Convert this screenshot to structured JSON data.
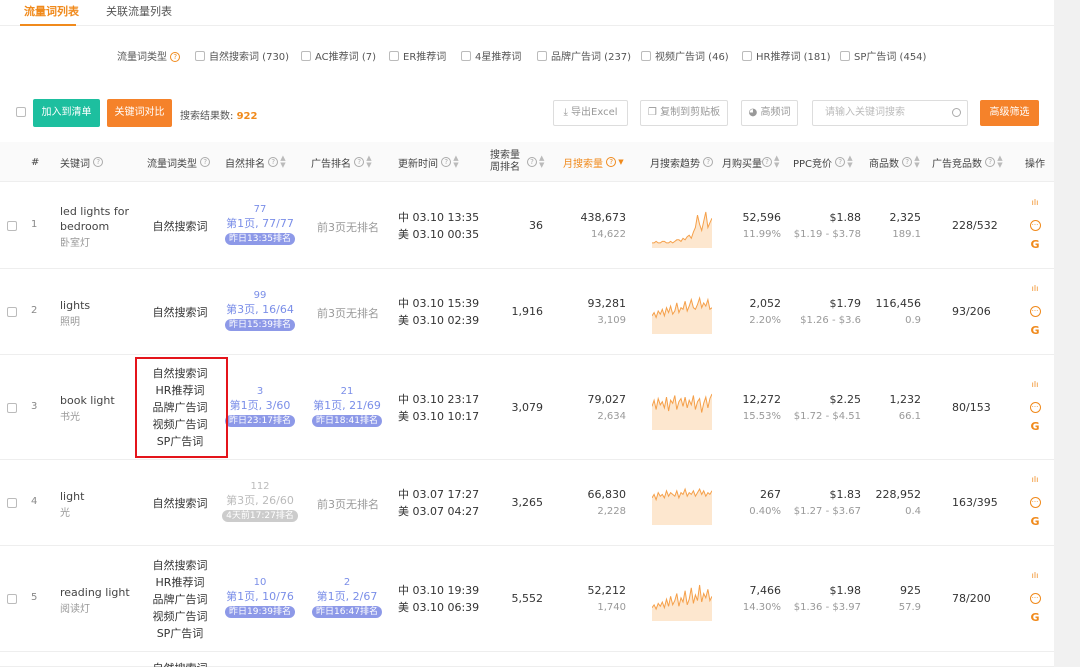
{
  "tabs": [
    "流量词列表",
    "关联流量列表"
  ],
  "filter": {
    "label": "流量词类型",
    "options": [
      "自然搜索词 (730)",
      "AC推荐词 (7)",
      "ER推荐词",
      "4星推荐词",
      "品牌广告词 (237)",
      "视频广告词 (46)",
      "HR推荐词 (181)",
      "SP广告词 (454)"
    ]
  },
  "toolbar": {
    "add_list": "加入到清单",
    "compare": "关键词对比",
    "result_label": "搜索结果数:",
    "result_count": "922",
    "export": "导出Excel",
    "copy": "复制到剪贴板",
    "high_freq": "高频词",
    "search_placeholder": "请输入关键词搜索",
    "advanced": "高级筛选"
  },
  "columns": [
    "#",
    "关键词",
    "流量词类型",
    "自然排名",
    "广告排名",
    "更新时间",
    "搜索量周排名",
    "月搜索量",
    "月搜索趋势",
    "月购买量",
    "PPC竞价",
    "商品数",
    "广告竞品数",
    "操作"
  ],
  "rows": [
    {
      "idx": "1",
      "kw": "led lights for bedroom",
      "kw_line1": "led lights for",
      "kw_line2": "bedroom",
      "cn": "卧室灯",
      "types": [
        "自然搜索词"
      ],
      "nat": {
        "top": "77",
        "pos": "第1页, 77/77",
        "pill": "昨日13:35排名",
        "grey": false
      },
      "ad": {
        "none": "前3页无排名"
      },
      "t1": "中 03.10 13:35",
      "t2": "美 03.10 00:35",
      "weekly": "36",
      "vol": "438,673",
      "vol2": "14,622",
      "buy": "52,596",
      "buy2": "11.99%",
      "ppc": "$1.88",
      "ppc2": "$1.19 - $3.78",
      "goods": "2,325",
      "goods2": "189.1",
      "adc": "228/532",
      "trend": [
        2,
        2,
        3,
        2,
        2,
        3,
        3,
        2,
        2,
        3,
        2,
        3,
        4,
        4,
        3,
        5,
        4,
        6,
        7,
        5,
        9,
        12,
        20,
        14,
        10,
        16,
        22,
        12,
        15,
        18
      ]
    },
    {
      "idx": "2",
      "kw": "lights",
      "kw_line1": "lights",
      "kw_line2": "",
      "cn": "照明",
      "types": [
        "自然搜索词"
      ],
      "nat": {
        "top": "99",
        "pos": "第3页, 16/64",
        "pill": "昨日15:39排名",
        "grey": false
      },
      "ad": {
        "none": "前3页无排名"
      },
      "t1": "中 03.10 15:39",
      "t2": "美 03.10 02:39",
      "weekly": "1,916",
      "vol": "93,281",
      "vol2": "3,109",
      "buy": "2,052",
      "buy2": "2.20%",
      "ppc": "$1.79",
      "ppc2": "$1.26 - $3.6",
      "goods": "116,456",
      "goods2": "0.9",
      "adc": "93/206",
      "trend": [
        10,
        12,
        9,
        13,
        11,
        14,
        10,
        15,
        12,
        16,
        11,
        13,
        18,
        12,
        15,
        14,
        19,
        13,
        16,
        20,
        15,
        14,
        17,
        21,
        15,
        18,
        16,
        20,
        14,
        15
      ]
    },
    {
      "idx": "3",
      "kw": "book light",
      "kw_line1": "book light",
      "kw_line2": "",
      "cn": "书光",
      "types": [
        "自然搜索词",
        "HR推荐词",
        "品牌广告词",
        "视频广告词",
        "SP广告词"
      ],
      "nat": {
        "top": "3",
        "pos": "第1页, 3/60",
        "pill": "昨日23:17排名",
        "grey": false
      },
      "ad": {
        "top": "21",
        "pos": "第1页, 21/69",
        "pill": "昨日18:41排名"
      },
      "t1": "中 03.10 23:17",
      "t2": "美 03.10 10:17",
      "weekly": "3,079",
      "vol": "79,027",
      "vol2": "2,634",
      "buy": "12,272",
      "buy2": "15.53%",
      "ppc": "$2.25",
      "ppc2": "$1.72 - $4.51",
      "goods": "1,232",
      "goods2": "66.1",
      "adc": "80/153",
      "trend": [
        14,
        18,
        12,
        19,
        15,
        17,
        13,
        20,
        11,
        18,
        16,
        21,
        12,
        17,
        19,
        14,
        20,
        13,
        18,
        15,
        21,
        12,
        17,
        19,
        10,
        16,
        20,
        13,
        19,
        22
      ]
    },
    {
      "idx": "4",
      "kw": "light",
      "kw_line1": "light",
      "kw_line2": "",
      "cn": "光",
      "types": [
        "自然搜索词"
      ],
      "nat": {
        "top": "112",
        "pos": "第3页, 26/60",
        "pill": "4天前17:27排名",
        "grey": true
      },
      "ad": {
        "none": "前3页无排名"
      },
      "t1": "中 03.07 17:27",
      "t2": "美 03.07 04:27",
      "weekly": "3,265",
      "vol": "66,830",
      "vol2": "2,228",
      "buy": "267",
      "buy2": "0.40%",
      "ppc": "$1.83",
      "ppc2": "$1.27 - $3.67",
      "goods": "228,952",
      "goods2": "0.4",
      "adc": "163/395",
      "trend": [
        14,
        16,
        13,
        17,
        15,
        16,
        14,
        18,
        15,
        17,
        16,
        15,
        18,
        14,
        17,
        16,
        19,
        15,
        17,
        16,
        18,
        15,
        17,
        19,
        16,
        18,
        15,
        17,
        16,
        18
      ]
    },
    {
      "idx": "5",
      "kw": "reading light",
      "kw_line1": "reading light",
      "kw_line2": "",
      "cn": "阅读灯",
      "types": [
        "自然搜索词",
        "HR推荐词",
        "品牌广告词",
        "视频广告词",
        "SP广告词"
      ],
      "nat": {
        "top": "10",
        "pos": "第1页, 10/76",
        "pill": "昨日19:39排名",
        "grey": false
      },
      "ad": {
        "top": "2",
        "pos": "第1页, 2/67",
        "pill": "昨日16:47排名"
      },
      "t1": "中 03.10 19:39",
      "t2": "美 03.10 06:39",
      "weekly": "5,552",
      "vol": "52,212",
      "vol2": "1,740",
      "buy": "7,466",
      "buy2": "14.30%",
      "ppc": "$1.98",
      "ppc2": "$1.36 - $3.97",
      "goods": "925",
      "goods2": "57.9",
      "adc": "78/200",
      "trend": [
        8,
        10,
        7,
        11,
        9,
        12,
        8,
        14,
        9,
        16,
        10,
        13,
        18,
        9,
        15,
        12,
        20,
        10,
        14,
        22,
        11,
        17,
        13,
        24,
        12,
        18,
        15,
        21,
        13,
        16
      ]
    }
  ],
  "row6_type": "自然搜索词",
  "ops_icons": [
    "bar-chart-icon",
    "more-icon",
    "google-icon"
  ],
  "colors": {
    "accent": "#f08a1c",
    "green": "#1dbf9f",
    "orange_btn": "#f5822a",
    "rank_blue": "#7a8ee8",
    "highlight": "#e4141b"
  }
}
